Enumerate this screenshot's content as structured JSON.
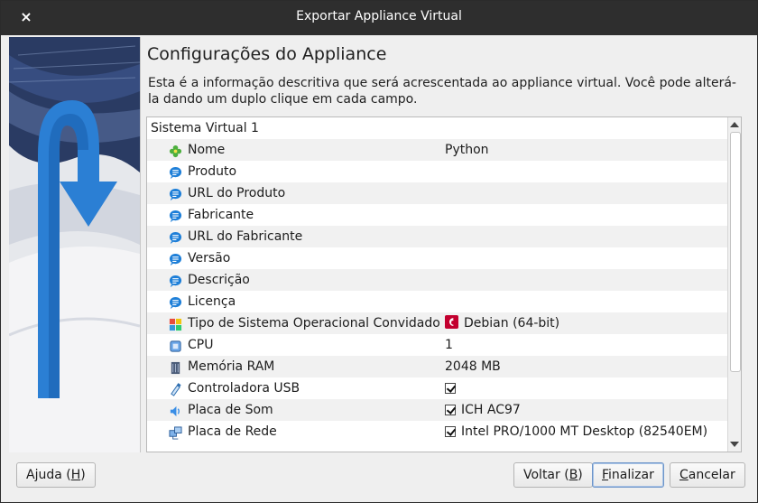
{
  "window": {
    "title": "Exportar Appliance Virtual",
    "close_symbol": "×"
  },
  "heading": "Configurações do Appliance",
  "description": "Esta é a informação descritiva que será acrescentada ao appliance virtual. Você pode alterá-la dando um duplo clique em cada campo.",
  "tree": {
    "root": "Sistema Virtual 1",
    "rows": [
      {
        "label": "Nome",
        "icon": "name-icon",
        "value": "Python",
        "checked": false
      },
      {
        "label": "Produto",
        "icon": "comment-icon",
        "value": "",
        "checked": false
      },
      {
        "label": "URL do Produto",
        "icon": "comment-icon",
        "value": "",
        "checked": false
      },
      {
        "label": "Fabricante",
        "icon": "comment-icon",
        "value": "",
        "checked": false
      },
      {
        "label": "URL do Fabricante",
        "icon": "comment-icon",
        "value": "",
        "checked": false
      },
      {
        "label": "Versão",
        "icon": "comment-icon",
        "value": "",
        "checked": false
      },
      {
        "label": "Descrição",
        "icon": "comment-icon",
        "value": "",
        "checked": false
      },
      {
        "label": "Licença",
        "icon": "comment-icon",
        "value": "",
        "checked": false
      },
      {
        "label": "Tipo de Sistema Operacional Convidado",
        "icon": "os-type-icon",
        "value": "Debian (64-bit)",
        "value_icon": "debian-icon",
        "checked": false
      },
      {
        "label": "CPU",
        "icon": "cpu-icon",
        "value": "1",
        "checked": false
      },
      {
        "label": "Memória RAM",
        "icon": "ram-icon",
        "value": "2048 MB",
        "checked": false
      },
      {
        "label": "Controladora USB",
        "icon": "usb-icon",
        "value": "",
        "checked": true
      },
      {
        "label": "Placa de Som",
        "icon": "sound-icon",
        "value": "ICH AC97",
        "checked": true
      },
      {
        "label": "Placa de Rede",
        "icon": "network-icon",
        "value": "Intel PRO/1000 MT Desktop (82540EM)",
        "checked": true
      }
    ]
  },
  "buttons": {
    "help": {
      "pre": "Ajuda (",
      "key": "H",
      "post": ")"
    },
    "back": {
      "pre": "Voltar (",
      "key": "B",
      "post": ")"
    },
    "finish": {
      "pre": "",
      "key": "F",
      "post": "inalizar"
    },
    "cancel": {
      "pre": "",
      "key": "C",
      "post": "ancelar"
    }
  },
  "colors": {
    "titlebar": "#2e2e2e",
    "accent_blue": "#2b7fd4",
    "comment_icon": "#1e7fd8"
  }
}
